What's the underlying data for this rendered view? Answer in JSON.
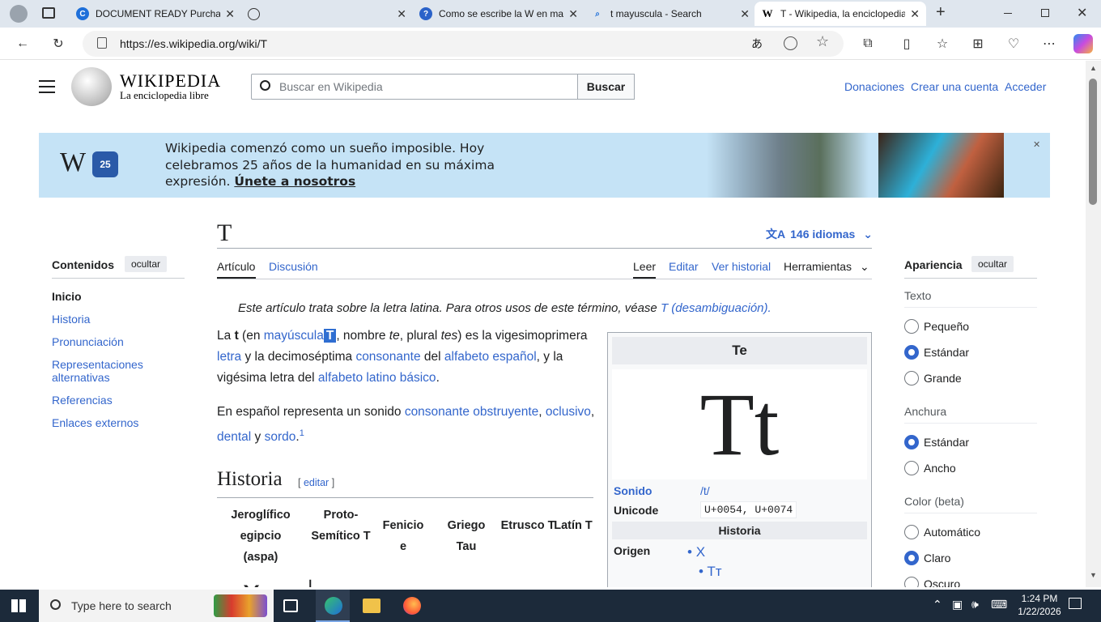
{
  "browser": {
    "tabs": [
      {
        "title": "DOCUMENT READY Purchase",
        "fav": "C"
      },
      {
        "title": "",
        "fav": "globe"
      },
      {
        "title": "Como se escribe la W en ma",
        "fav": "?"
      },
      {
        "title": "t mayuscula - Search",
        "fav": "search"
      },
      {
        "title": "T - Wikipedia, la enciclopedia",
        "fav": "W"
      }
    ],
    "url": "https://es.wikipedia.org/wiki/T"
  },
  "header": {
    "wordmark": "WIKIPEDIA",
    "tagline": "La enciclopedia libre",
    "search_placeholder": "Buscar en Wikipedia",
    "search_button": "Buscar",
    "links": [
      "Donaciones",
      "Crear una cuenta",
      "Acceder"
    ]
  },
  "banner": {
    "text": "Wikipedia comenzó como un sueño imposible. Hoy celebramos 25 años de la humanidad en su máxima expresión. ",
    "cta": "Únete a nosotros",
    "badge": "25"
  },
  "article": {
    "title": "T",
    "languages": "146 idiomas",
    "tabs_left": [
      "Artículo",
      "Discusión"
    ],
    "tabs_right": [
      "Leer",
      "Editar",
      "Ver historial",
      "Herramientas"
    ],
    "hatnote": "Este artículo trata sobre la letra latina. Para otros usos de este término, véase ",
    "hatnote_link": "T (desambiguación).",
    "section_history": "Historia",
    "edit_link": "editar",
    "footnote": "1"
  },
  "toc": {
    "heading": "Contenidos",
    "hide": "ocultar",
    "items": [
      "Inicio",
      "Historia",
      "Pronunciación",
      "Representaciones alternativas",
      "Referencias",
      "Enlaces externos"
    ]
  },
  "appearance": {
    "heading": "Apariencia",
    "hide": "ocultar",
    "text_label": "Texto",
    "text_options": [
      "Pequeño",
      "Estándar",
      "Grande"
    ],
    "width_label": "Anchura",
    "width_options": [
      "Estándar",
      "Ancho"
    ],
    "color_label": "Color (beta)",
    "color_options": [
      "Automático",
      "Claro",
      "Oscuro"
    ]
  },
  "history_table": {
    "headers": [
      "Jeroglífico egipcio (aspa)",
      "Proto-Semítico T",
      "Fenicio e",
      "Griego Tau",
      "Etrusco T",
      "Latín T"
    ]
  },
  "infobox": {
    "title": "Te",
    "glyph": "Tt",
    "sonido_label": "Sonido",
    "sonido_value": "/t/",
    "unicode_label": "Unicode",
    "unicode_value": "U+0054, U+0074",
    "historia": "Historia",
    "origen_label": "Origen",
    "origen_items": [
      "X",
      "Tт"
    ]
  },
  "taskbar": {
    "search": "Type here to search",
    "time": "1:24 PM",
    "date": "1/22/2026"
  },
  "colors": {
    "link": "#3366cc",
    "banner": "#c5e3f6",
    "taskbar": "#1c2a3a"
  }
}
